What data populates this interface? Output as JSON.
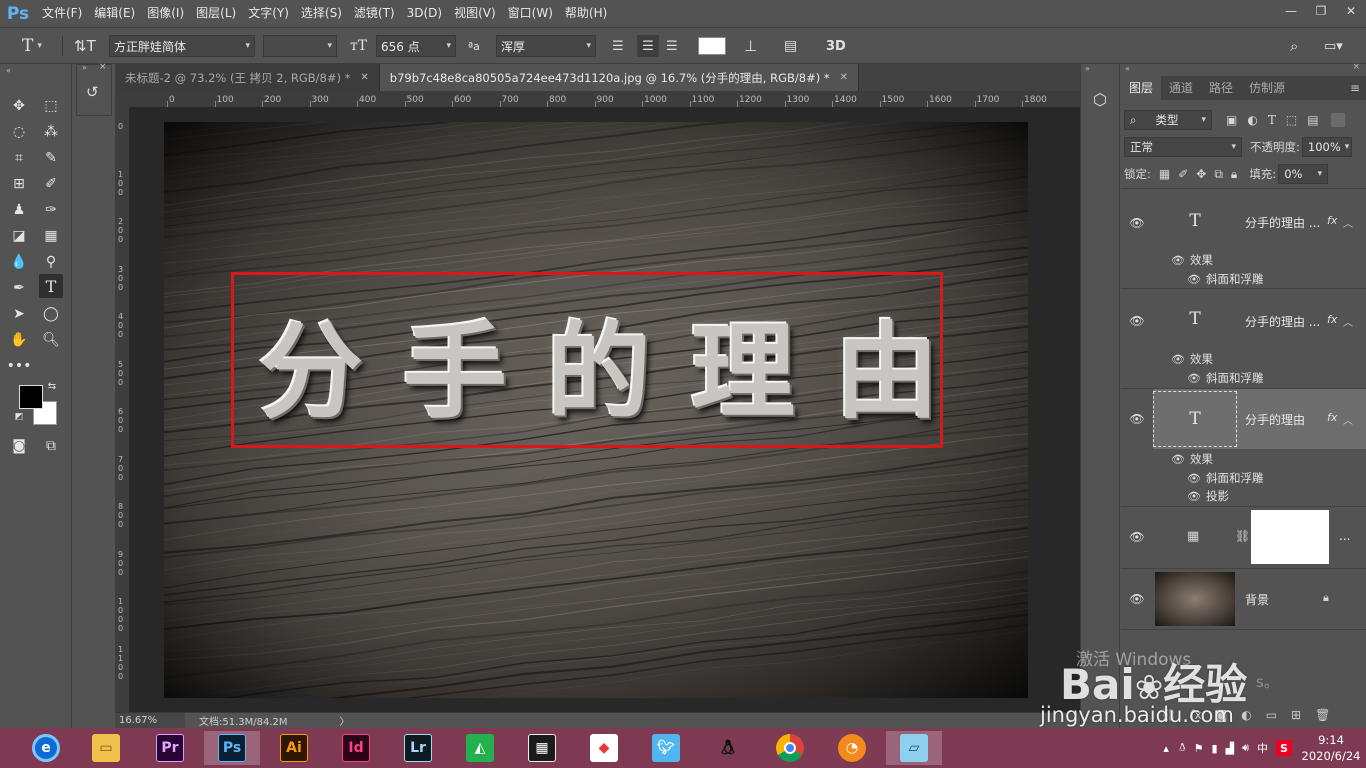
{
  "app": {
    "logo": "Ps"
  },
  "menu": [
    "文件(F)",
    "编辑(E)",
    "图像(I)",
    "图层(L)",
    "文字(Y)",
    "选择(S)",
    "滤镜(T)",
    "3D(D)",
    "视图(V)",
    "窗口(W)",
    "帮助(H)"
  ],
  "window_controls": {
    "minimize": "—",
    "restore": "❐",
    "close": "✕"
  },
  "options": {
    "tool_glyph": "T",
    "font_family": "方正胖娃简体",
    "font_style": "",
    "font_size": "656 点",
    "aa_label": "ªa",
    "antialias": "浑厚",
    "three_d": "3D",
    "text_color": "#ffffff"
  },
  "tabs": [
    {
      "label": "未标题-2 @ 73.2% (王 拷贝 2, RGB/8#) *",
      "active": false
    },
    {
      "label": "b79b7c48e8ca80505a724ee473d1120a.jpg @ 16.7% (分手的理由, RGB/8#) *",
      "active": true
    }
  ],
  "ruler": {
    "h_labels": [
      "0",
      "100",
      "200",
      "300",
      "400",
      "500",
      "600",
      "700",
      "800",
      "900",
      "1000",
      "1100",
      "1200",
      "1300",
      "1400",
      "1500",
      "1600",
      "1700",
      "1800"
    ],
    "v_labels": [
      "0",
      "100",
      "200",
      "300",
      "400",
      "500",
      "600",
      "700",
      "800",
      "900",
      "1000",
      "1100"
    ]
  },
  "canvas": {
    "text_chars": [
      "分",
      "手",
      "的",
      "理",
      "由"
    ]
  },
  "status": {
    "zoom": "16.67%",
    "doc": "文档:51.3M/84.2M",
    "arrow": "〉"
  },
  "layers_panel": {
    "tabs": [
      {
        "label": "图层",
        "active": true
      },
      {
        "label": "通道",
        "active": false
      },
      {
        "label": "路径",
        "active": false
      },
      {
        "label": "仿制源",
        "active": false
      }
    ],
    "filter_kind": "类型",
    "blend_mode": "正常",
    "opacity_label": "不透明度:",
    "opacity_value": "100%",
    "lock_label": "锁定:",
    "fill_label": "填充:",
    "fill_value": "0%",
    "layers": [
      {
        "name": "分手的理由 ...",
        "type": "text",
        "fx": "fx",
        "effects_label": "效果",
        "effects": [
          "斜面和浮雕"
        ]
      },
      {
        "name": "分手的理由 ...",
        "type": "text",
        "fx": "fx",
        "effects_label": "效果",
        "effects": [
          "斜面和浮雕"
        ]
      },
      {
        "name": "分手的理由",
        "type": "text",
        "fx": "fx",
        "selected": true,
        "effects_label": "效果",
        "effects": [
          "斜面和浮雕",
          "投影"
        ]
      },
      {
        "name": "...",
        "type": "adjustment"
      },
      {
        "name": "背景",
        "type": "image",
        "locked": true
      }
    ]
  },
  "taskbar": {
    "apps": [
      {
        "name": "browser",
        "label": ""
      },
      {
        "name": "file-explorer",
        "label": ""
      },
      {
        "name": "premiere",
        "label": "Pr"
      },
      {
        "name": "photoshop",
        "label": "Ps",
        "active": true
      },
      {
        "name": "illustrator",
        "label": "Ai"
      },
      {
        "name": "indesign",
        "label": "Id"
      },
      {
        "name": "lightroom",
        "label": "Lr"
      },
      {
        "name": "green-app",
        "label": ""
      },
      {
        "name": "video-app",
        "label": ""
      },
      {
        "name": "colorful-app",
        "label": ""
      },
      {
        "name": "bird-app",
        "label": ""
      },
      {
        "name": "qq",
        "label": ""
      },
      {
        "name": "chrome",
        "label": ""
      },
      {
        "name": "orange-app",
        "label": ""
      },
      {
        "name": "notes-app",
        "label": ""
      }
    ],
    "tray_ime": "中",
    "time": "9:14",
    "date": "2020/6/24"
  },
  "watermark": {
    "activate": "激活 Windows",
    "brand": "Bai",
    "brand2": "经验",
    "url": "jingyan.baidu.com",
    "sub": "s。"
  }
}
